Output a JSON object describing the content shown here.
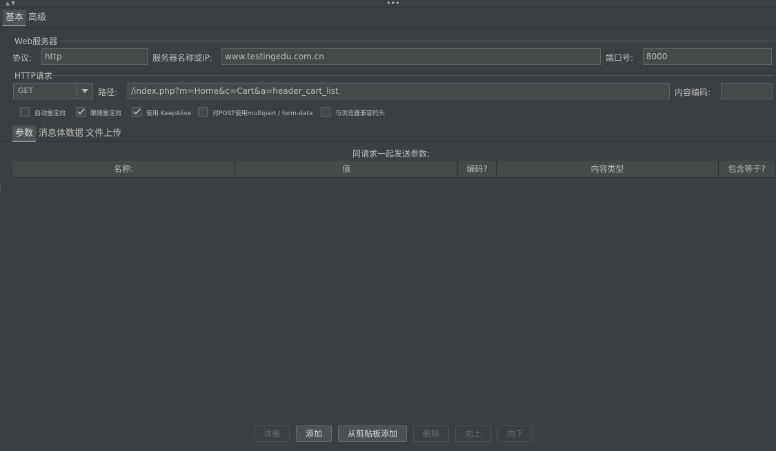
{
  "top_tabs": [
    {
      "label": "基本",
      "selected": true
    },
    {
      "label": "高级",
      "selected": false
    }
  ],
  "web_server": {
    "title": "Web服务器",
    "protocol_label": "协议:",
    "protocol_value": "http",
    "server_label": "服务器名称或IP:",
    "server_value": "www.testingedu.com.cn",
    "port_label": "端口号:",
    "port_value": "8000"
  },
  "http_request": {
    "title": "HTTP请求",
    "method": "GET",
    "path_label": "路径:",
    "path_value": "/index.php?m=Home&c=Cart&a=header_cart_list",
    "encoding_label": "内容编码:",
    "encoding_value": ""
  },
  "options": [
    {
      "label": "自动重定向",
      "checked": false
    },
    {
      "label": "跟随重定向",
      "checked": true
    },
    {
      "label": "使用 KeepAlive",
      "checked": true
    },
    {
      "label": "对POST使用multipart / form-data",
      "checked": false
    },
    {
      "label": "与浏览器兼容的头",
      "checked": false
    }
  ],
  "sub_tabs": [
    {
      "label": "参数",
      "selected": true
    },
    {
      "label": "消息体数据",
      "selected": false
    },
    {
      "label": "文件上传",
      "selected": false
    }
  ],
  "params": {
    "caption": "同请求一起发送参数:",
    "columns": [
      "名称:",
      "值",
      "编码?",
      "内容类型",
      "包含等于?"
    ]
  },
  "buttons": [
    {
      "label": "详细",
      "enabled": false
    },
    {
      "label": "添加",
      "enabled": true
    },
    {
      "label": "从剪贴板添加",
      "enabled": true
    },
    {
      "label": "删除",
      "enabled": false
    },
    {
      "label": "向上",
      "enabled": false
    },
    {
      "label": "向下",
      "enabled": false
    }
  ],
  "colors": {
    "background": "#3c3f41",
    "field": "#45494a",
    "text": "#bbbbbb"
  }
}
